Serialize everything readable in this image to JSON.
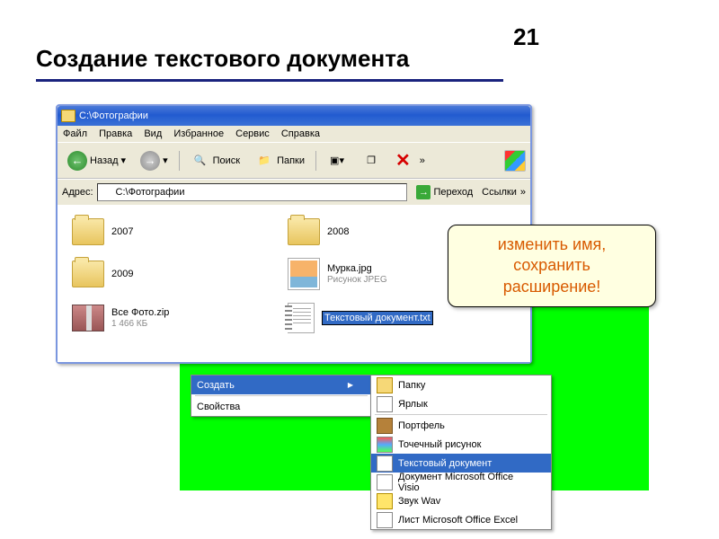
{
  "page_number": "21",
  "title": "Создание текстового документа",
  "window": {
    "title": "C:\\Фотографии",
    "menu": [
      "Файл",
      "Правка",
      "Вид",
      "Избранное",
      "Сервис",
      "Справка"
    ],
    "toolbar": {
      "back": "Назад",
      "search": "Поиск",
      "folders": "Папки"
    },
    "address": {
      "label": "Адрес:",
      "value": "C:\\Фотографии",
      "go": "Переход",
      "links": "Ссылки"
    },
    "files": [
      {
        "name": "2007",
        "type": "folder"
      },
      {
        "name": "2008",
        "type": "folder"
      },
      {
        "name": "2009",
        "type": "folder"
      },
      {
        "name": "Мурка.jpg",
        "sub": "Рисунок JPEG",
        "type": "img"
      },
      {
        "name": "Все Фото.zip",
        "sub": "1 466 КБ",
        "type": "zip"
      },
      {
        "name": "Текстовый документ.txt",
        "type": "txt",
        "selected": true
      }
    ]
  },
  "callout": {
    "line1": "изменить имя,",
    "line2": "сохранить",
    "line3": "расширение!"
  },
  "context_menu_left": [
    {
      "label": "Создать",
      "hi": true,
      "arrow": true
    },
    {
      "label": "Свойства"
    }
  ],
  "context_menu_right": [
    {
      "label": "Папку",
      "ic": "folder"
    },
    {
      "label": "Ярлык",
      "ic": "link"
    },
    {
      "sep": true
    },
    {
      "label": "Портфель",
      "ic": "brief"
    },
    {
      "label": "Точечный рисунок",
      "ic": "bmp"
    },
    {
      "label": "Текстовый документ",
      "ic": "doc",
      "hi": true
    },
    {
      "label": "Документ Microsoft Office Visio",
      "ic": "visio"
    },
    {
      "label": "Звук Wav",
      "ic": "wav"
    },
    {
      "label": "Лист Microsoft Office Excel",
      "ic": "xl"
    }
  ]
}
